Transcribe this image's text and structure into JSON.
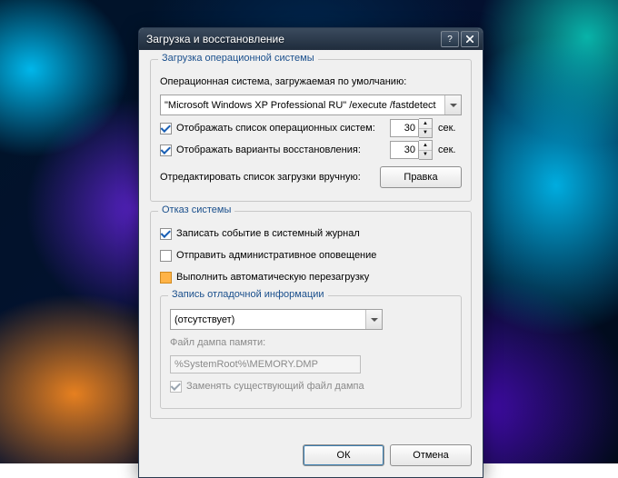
{
  "window": {
    "title": "Загрузка и восстановление"
  },
  "startup": {
    "group_title": "Загрузка операционной системы",
    "default_os_label": "Операционная система, загружаемая по умолчанию:",
    "default_os_value": "\"Microsoft Windows XP Professional RU\" /execute /fastdetect",
    "show_os_list_label": "Отображать список операционных систем:",
    "show_os_list_seconds": "30",
    "show_recovery_label": "Отображать варианты восстановления:",
    "show_recovery_seconds": "30",
    "sec_suffix": "сек.",
    "edit_manual_label": "Отредактировать список загрузки вручную:",
    "edit_button": "Правка"
  },
  "failure": {
    "group_title": "Отказ системы",
    "write_event_label": "Записать событие в системный журнал",
    "send_alert_label": "Отправить административное оповещение",
    "auto_restart_label": "Выполнить автоматическую перезагрузку"
  },
  "debug": {
    "group_title": "Запись отладочной информации",
    "type_value": "(отсутствует)",
    "dump_file_label": "Файл дампа памяти:",
    "dump_file_value": "%SystemRoot%\\MEMORY.DMP",
    "overwrite_label": "Заменять существующий файл дампа"
  },
  "buttons": {
    "ok": "ОК",
    "cancel": "Отмена"
  }
}
